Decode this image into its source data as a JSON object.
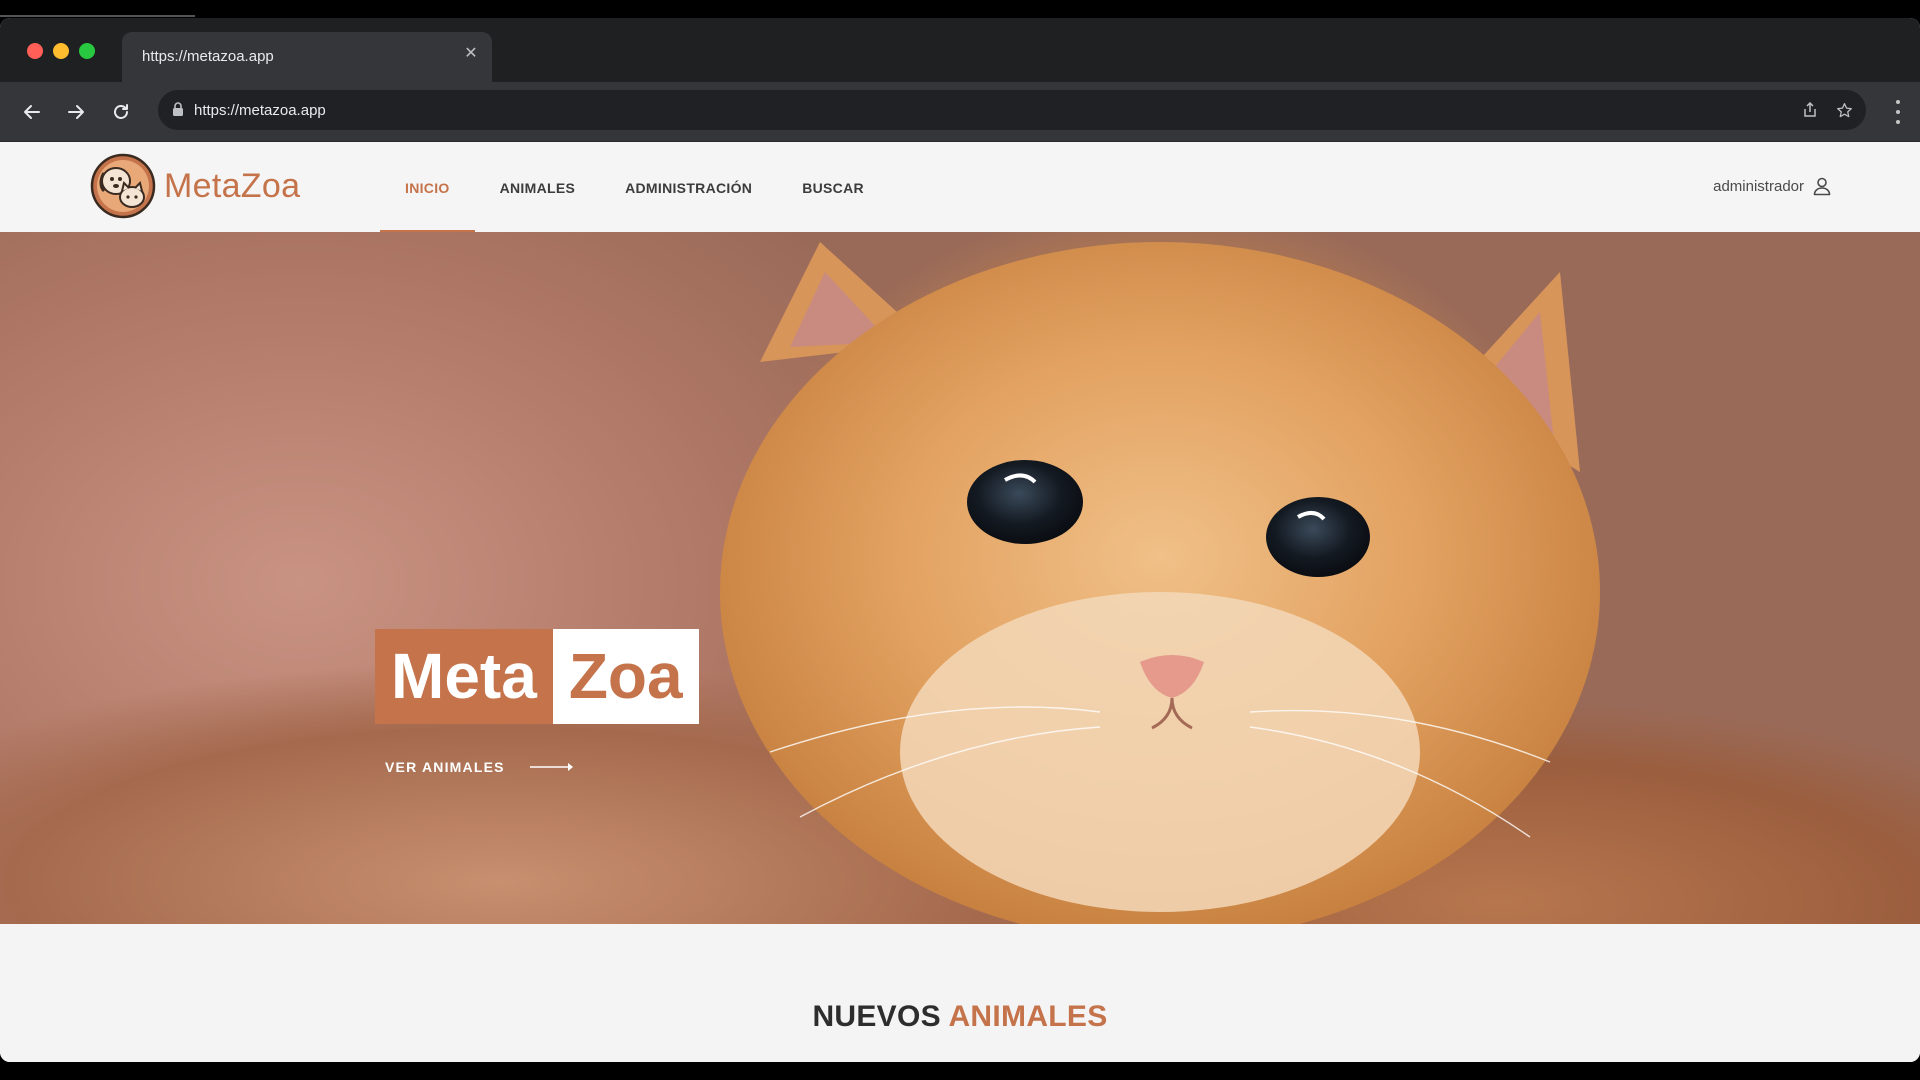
{
  "browser": {
    "tab_title": "https://metazoa.app",
    "url": "https://metazoa.app"
  },
  "site": {
    "brand": "MetaZoa",
    "nav": [
      {
        "label": "INICIO",
        "active": true
      },
      {
        "label": "ANIMALES",
        "active": false
      },
      {
        "label": "ADMINISTRACIÓN",
        "active": false
      },
      {
        "label": "BUSCAR",
        "active": false
      }
    ],
    "user_label": "administrador"
  },
  "hero": {
    "brand_part1": "Meta",
    "brand_part2": "Zoa",
    "cta_label": "VER ANIMALES"
  },
  "section": {
    "title_part1": "NUEVOS",
    "title_part2": "ANIMALES"
  },
  "colors": {
    "accent": "#c5734a",
    "chrome_dark": "#1f2022",
    "chrome_toolbar": "#35363a"
  }
}
